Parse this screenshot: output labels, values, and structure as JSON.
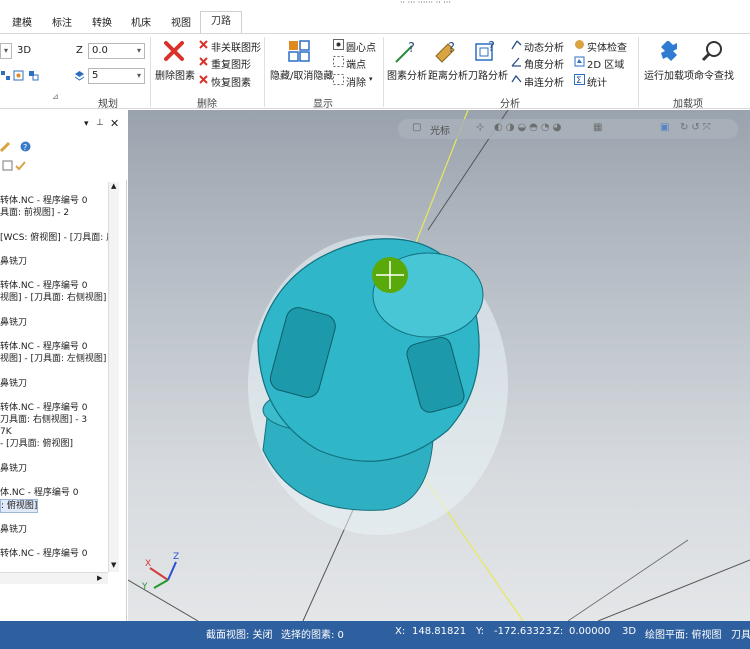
{
  "tabs": [
    "建模",
    "标注",
    "转换",
    "机床",
    "视图",
    "刀路"
  ],
  "top_fragment": "·· ··· ······ ·· ···",
  "ribbon": {
    "planes": {
      "mode_3d": "3D",
      "z_label": "Z",
      "z_value": "0.0",
      "level_value": "5",
      "group_label": "规划"
    },
    "delete": {
      "delete_entity": "删除图素",
      "non_associated": "非关联图形",
      "duplicate": "重复图形",
      "restore": "恢复图素",
      "group_label": "删除"
    },
    "display": {
      "hide_unhide": "隐藏/取消隐藏",
      "arc_center": "圆心点",
      "endpoints": "端点",
      "clear": "消除",
      "group_label": "显示"
    },
    "analyze": {
      "entity_analysis": "图素分析",
      "distance_analysis": "距离分析",
      "toolpath_analysis": "刀路分析",
      "dynamic_analysis": "动态分析",
      "angle_analysis": "角度分析",
      "chain_analysis": "串连分析",
      "solid_check": "实体检查",
      "area_2d": "2D 区域",
      "statistics": "统计",
      "group_label": "分析"
    },
    "addins": {
      "run_addin": "运行加载项",
      "command_finder": "命令查找",
      "group_label": "加载项"
    }
  },
  "tree_lines": [
    "转体.NC - 程序编号 0",
    "具面: 前视图] - 2",
    "[WCS: 俯视图] - [刀具面: 后",
    "鼻铣刀",
    "转体.NC - 程序编号 0",
    "视图] - [刀具面: 右侧视图]",
    "鼻铣刀",
    "转体.NC - 程序编号 0",
    "视图] - [刀具面: 左侧视图]",
    "鼻铣刀",
    "转体.NC - 程序编号 0",
    "刀具面: 右侧视图] - 3",
    "7K",
    "- [刀具面: 俯视图]",
    "鼻铣刀",
    "体.NC - 程序编号 0",
    ": 俯视图]",
    "鼻铣刀",
    "转体.NC - 程序编号 0"
  ],
  "viewport": {
    "toolbar_label": "光标",
    "axes": {
      "x": "X",
      "y": "Y",
      "z": "Z"
    }
  },
  "status": {
    "section_view": "截面视图: 关闭",
    "selected": "选择的图素: 0",
    "x_label": "X:",
    "x_value": "148.81821",
    "y_label": "Y:",
    "y_value": "-172.63323",
    "z_label": "Z:",
    "z_value": "0.00000",
    "mode": "3D",
    "plane": "绘图平面: 俯视图",
    "tool_plane": "刀具"
  },
  "colors": {
    "status_bg": "#2e5f9e",
    "part": "#2fb6c8",
    "cursor": "#5aa90a"
  }
}
